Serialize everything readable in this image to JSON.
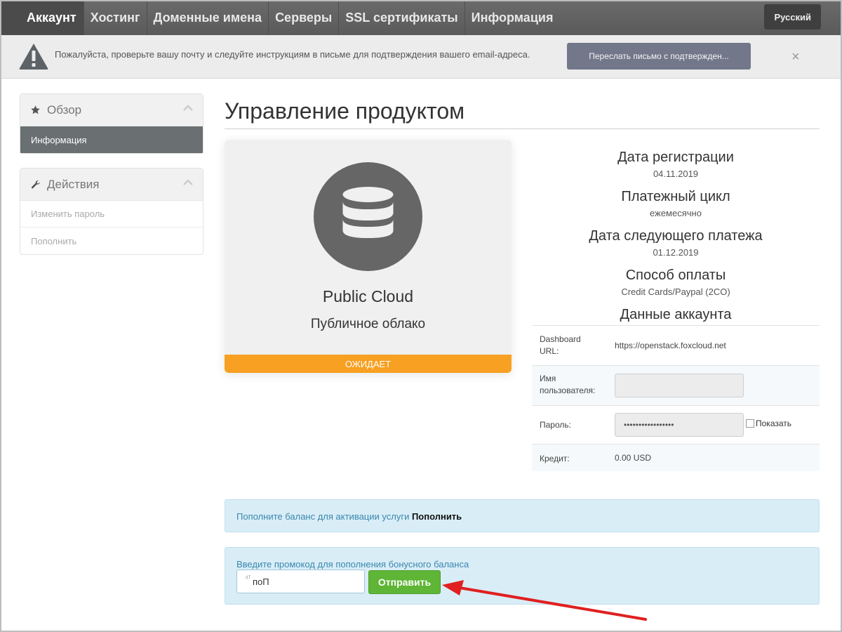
{
  "nav": {
    "items": [
      "Аккаунт",
      "Хостинг",
      "Доменные имена",
      "Серверы",
      "SSL сертификаты",
      "Информация"
    ],
    "active_index": 0,
    "language": "Русский"
  },
  "alert": {
    "text": "Пожалуйста, проверьте вашу почту и следуйте инструкциям в письме для подтверждения вашего email-адреса.",
    "button": "Переслать письмо с подтвержден...",
    "close": "×",
    "icon": "warning-triangle-icon"
  },
  "sidebar": {
    "overview": {
      "title": "Обзор",
      "icon": "star-icon",
      "items": [
        "Информация"
      ]
    },
    "actions": {
      "title": "Действия",
      "icon": "wrench-icon",
      "items": [
        "Изменить пароль",
        "Пополнить"
      ]
    }
  },
  "main": {
    "title": "Управление продуктом",
    "product": {
      "icon": "database-icon",
      "name": "Public Cloud",
      "subtitle": "Публичное облако",
      "status": "ОЖИДАЕТ"
    },
    "details": [
      {
        "label": "Дата регистрации",
        "value": "04.11.2019"
      },
      {
        "label": "Платежный цикл",
        "value": "ежемесячно"
      },
      {
        "label": "Дата следующего платежа",
        "value": "01.12.2019"
      },
      {
        "label": "Способ оплаты",
        "value": "Credit Cards/Paypal (2CO)"
      }
    ],
    "account_heading": "Данные аккаунта",
    "account": {
      "dashboard_label": "Dashboard URL:",
      "dashboard_url": "https://openstack.foxcloud.net",
      "username_label": "Имя пользователя:",
      "username_value": "",
      "password_label": "Пароль:",
      "password_value": "•••••••••••••••••",
      "show_label": "Показать",
      "credit_label": "Кредит:",
      "credit_value": "0.00 USD"
    },
    "topup": {
      "text": "Пополните баланс для активации услуги ",
      "link": "Пополнить"
    },
    "promo": {
      "text": "Введите промокод для пополнения бонусного баланса",
      "input_value": "поП",
      "submit": "Отправить"
    }
  },
  "colors": {
    "nav_bg": "#5f5f5f",
    "status_orange": "#f7a021",
    "submit_green": "#5fb536",
    "info_blue": "#d9edf7",
    "annotation_arrow": "#e02020"
  }
}
